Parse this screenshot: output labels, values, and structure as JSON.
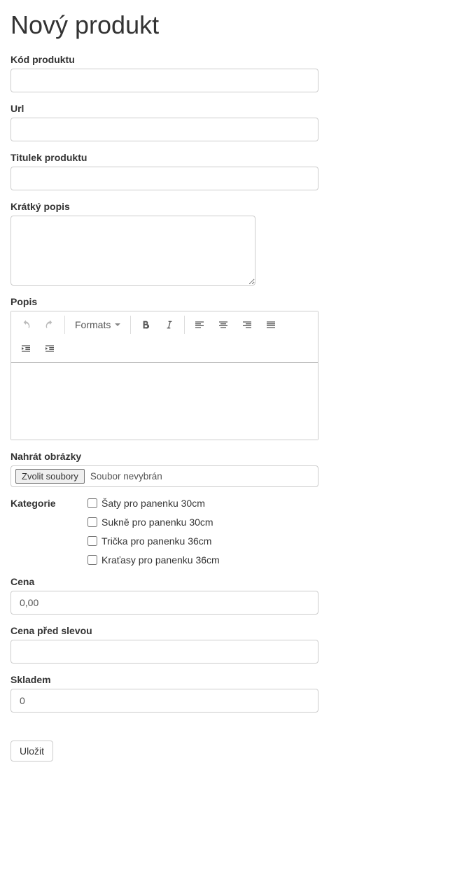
{
  "page_title": "Nový produkt",
  "labels": {
    "code": "Kód produktu",
    "url": "Url",
    "title": "Titulek produktu",
    "short_desc": "Krátký popis",
    "desc": "Popis",
    "upload": "Nahrát obrázky",
    "category": "Kategorie",
    "price": "Cena",
    "price_before": "Cena před slevou",
    "stock": "Skladem"
  },
  "editor": {
    "formats_label": "Formats"
  },
  "file": {
    "button": "Zvolit soubory",
    "status": "Soubor nevybrán"
  },
  "categories": [
    {
      "label": "Šaty pro panenku 30cm",
      "checked": false
    },
    {
      "label": "Sukně pro panenku 30cm",
      "checked": false
    },
    {
      "label": "Trička pro panenku 36cm",
      "checked": false
    },
    {
      "label": "Kraťasy pro panenku 36cm",
      "checked": false
    }
  ],
  "values": {
    "code": "",
    "url": "",
    "title": "",
    "short_desc": "",
    "desc": "",
    "price": "0,00",
    "price_before": "",
    "stock": "0"
  },
  "submit_label": "Uložit"
}
